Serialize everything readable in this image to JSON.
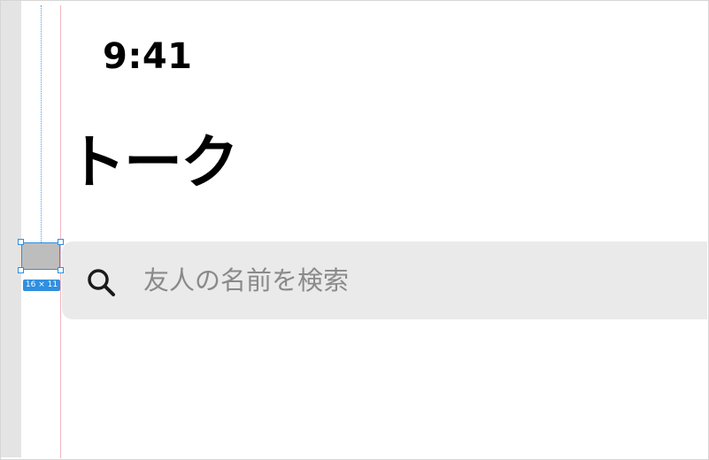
{
  "status_bar": {
    "time": "9:41"
  },
  "header": {
    "title": "トーク"
  },
  "search": {
    "placeholder": "友人の名前を検索",
    "value": "",
    "icon": "search-icon"
  },
  "design_overlay": {
    "dimension_label": "16 × 11",
    "accent_color": "#2f8fe0",
    "guide_color": "#f4b6bd"
  },
  "colors": {
    "search_background": "#eaeaea",
    "placeholder_text": "#8a8a8a",
    "title_text": "#000000"
  }
}
